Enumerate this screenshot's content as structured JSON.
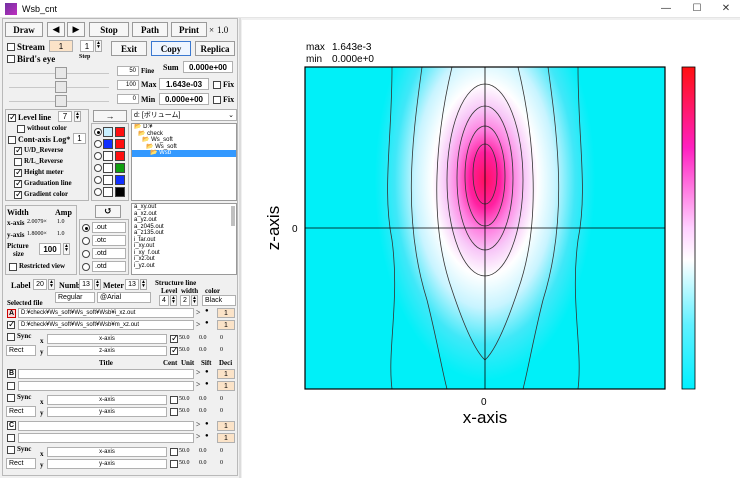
{
  "window": {
    "title": "Wsb_cnt",
    "min": "—",
    "max": "☐",
    "close": "✕"
  },
  "toolbar": {
    "draw": "Draw",
    "prev": "◀",
    "next": "▶",
    "stop": "Stop",
    "path": "Path",
    "print": "Print",
    "zoom_x": "×",
    "zoom": "1.0",
    "exit": "Exit",
    "copy": "Copy",
    "replica": "Replica"
  },
  "stream": {
    "label": "Stream",
    "value": "1",
    "step_value": "1",
    "step_label": "Step"
  },
  "birdseye": {
    "label": "Bird's eye"
  },
  "range": {
    "fine_value": "50",
    "fine_label": "Fine",
    "sum_label": "Sum",
    "sum_value": "0.000e+00",
    "max_left": "100",
    "max_label": "Max",
    "max_value": "1.643e-03",
    "min_left": "0",
    "min_label": "Min",
    "min_value": "0.000e+00",
    "fix_label": "Fix"
  },
  "options": {
    "level_line": "Level line",
    "level_value": "7",
    "without_color": "without color",
    "cont_axis": "Cont-axis Log*",
    "cont_value": "1",
    "ud_reverse": "U/D_Reverse",
    "rl_reverse": "R/L_Reverse",
    "height_meter": "Height meter",
    "graduation_line": "Graduation line",
    "gradient_color": "Gradient color"
  },
  "arrow": "→",
  "refresh": "↺",
  "drive": "d: [ボリューム]",
  "folders": [
    "D:¥",
    "check",
    "Ws_soft",
    "Ws_soft",
    "Wsb"
  ],
  "width_group": {
    "width": "Width",
    "amp": "Amp",
    "xaxis": "x-axis",
    "xval": "2.0079×",
    "xamp": "1.0",
    "yaxis": "y-axis",
    "yval": "1.8000×",
    "yamp": "1.0",
    "picture": "Picture",
    "size": "size",
    "size_value": "100",
    "restricted": "Restricted view"
  },
  "ext": [
    ".out",
    ".otc",
    ".otd",
    ".otd"
  ],
  "files": [
    "a_xy.out",
    "a_xz.out",
    "a_yz.out",
    "a_z045.out",
    "a_z135.out",
    "i_far.out",
    "i_xy.out",
    "i_xy_f.out",
    "i_xz.out",
    "i_yz.out"
  ],
  "labelrow": {
    "label": "Label",
    "label_v": "20",
    "numb": "Numb",
    "numb_v": "13",
    "meter": "Meter",
    "meter_v": "13",
    "structure": "Structure line",
    "level": "Level",
    "width": "width",
    "color": "color",
    "style": "Regular",
    "font": "@Arial",
    "level_v": "4",
    "width_v": "2",
    "color_v": "Black",
    "selected_file": "Selected file"
  },
  "selected": {
    "a_label": "A",
    "file1": "D:¥check¥Ws_soft¥Ws_soft¥Wsb¥i_xz.out",
    "file2": "D:¥check¥Ws_soft¥Ws_soft¥Wsb¥m_xz.out",
    "gt": ">",
    "dot": "●",
    "one": "1"
  },
  "sync": {
    "sync": "Sync",
    "rect": "Rect",
    "x": "x",
    "y": "y",
    "xaxis": "x-axis",
    "zaxis": "z-axis",
    "yaxis": "y-axis",
    "v50": "50.0",
    "v00": "0.0",
    "v0": "0"
  },
  "headers": {
    "title": "Title",
    "cent": "Cent",
    "unit": "Unit",
    "sift": "Sift",
    "deci": "Deci"
  },
  "sec_b": "B",
  "sec_c": "C",
  "plot": {
    "max_label": "max",
    "max_value": "1.643e-3",
    "min_label": "min",
    "min_value": "0.000e+0",
    "xlabel": "x-axis",
    "ylabel": "z-axis",
    "xtick": "0",
    "ytick": "0"
  }
}
